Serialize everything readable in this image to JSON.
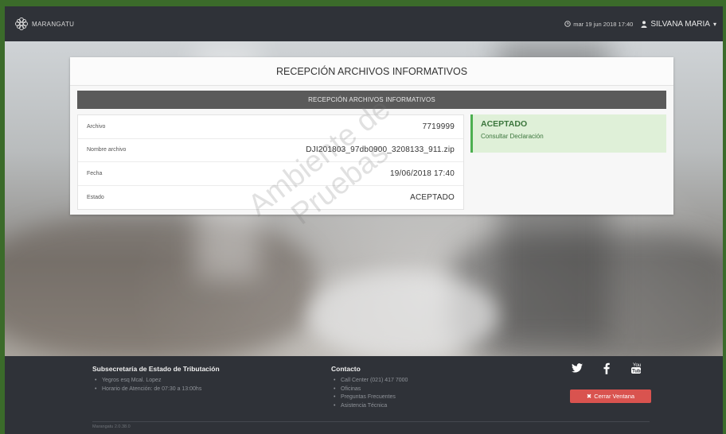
{
  "nav": {
    "brand": "MARANGATU",
    "datetime": "mar 19 jun 2018 17:40",
    "user": "SILVANA MARIA"
  },
  "card": {
    "title": "RECEPCIÓN ARCHIVOS INFORMATIVOS",
    "section_title": "RECEPCIÓN ARCHIVOS INFORMATIVOS",
    "rows": [
      {
        "label": "Archivo",
        "value": "7719999"
      },
      {
        "label": "Nombre archivo",
        "value": "DJI201803_97db0900_3208133_911.zip"
      },
      {
        "label": "Fecha",
        "value": "19/06/2018 17:40"
      },
      {
        "label": "Estado",
        "value": "ACEPTADO"
      }
    ],
    "status": {
      "title": "ACEPTADO",
      "link": "Consultar Declaración"
    }
  },
  "watermark": {
    "line1": "Ambiente de",
    "line2": "Pruebas"
  },
  "footer": {
    "org": {
      "title": "Subsecretaría de Estado de Tributación",
      "items": [
        "Yegros esq Mcal. Lopez",
        "Horario de Atención: de 07:30 a 13:00hs"
      ]
    },
    "contact": {
      "title": "Contacto",
      "items": [
        "Call Center (021) 417 7000",
        "Oficinas",
        "Preguntas Frecuentes",
        "Asistencia Técnica"
      ]
    },
    "social": [
      "twitter-icon",
      "facebook-icon",
      "youtube-icon"
    ],
    "close_button": "Cerrar Ventana",
    "version": "Marangatu 2.0.38.0"
  },
  "colors": {
    "navbar": "#2f3238",
    "success_bg": "#dff0d8",
    "success_text": "#3c763d",
    "danger": "#d9534f",
    "section_bar": "#5a5a5a"
  }
}
